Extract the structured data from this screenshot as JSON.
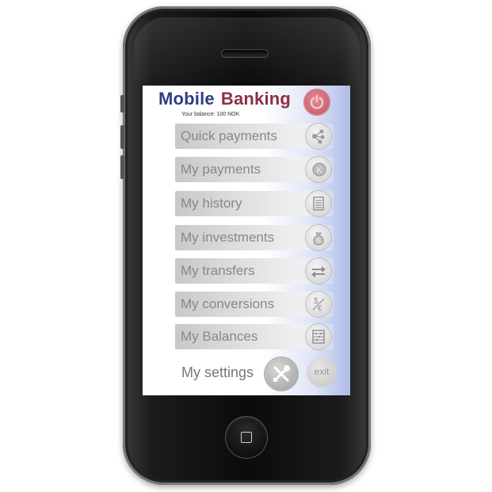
{
  "app": {
    "title_part1": "Mobile",
    "title_part2": "Banking",
    "balance_text": "Your balance:  100 NOK"
  },
  "menu": [
    {
      "label": "Quick payments",
      "icon": "quick-payments-icon"
    },
    {
      "label": "My payments",
      "icon": "krone-coin-icon"
    },
    {
      "label": "My history",
      "icon": "ledger-icon"
    },
    {
      "label": "My investments",
      "icon": "money-bag-icon"
    },
    {
      "label": "My transfers",
      "icon": "transfer-arrows-icon"
    },
    {
      "label": "My conversions",
      "icon": "currency-conversion-icon"
    },
    {
      "label": "My Balances",
      "icon": "abacus-icon"
    }
  ],
  "settings": {
    "label": "My settings",
    "icon": "tools-icon"
  },
  "exit": {
    "label": "exit"
  },
  "colors": {
    "title_mobile": "#2e3d84",
    "title_banking": "#8c2f45",
    "power_button": "#c9606e",
    "screen_accent": "#aebce8"
  }
}
